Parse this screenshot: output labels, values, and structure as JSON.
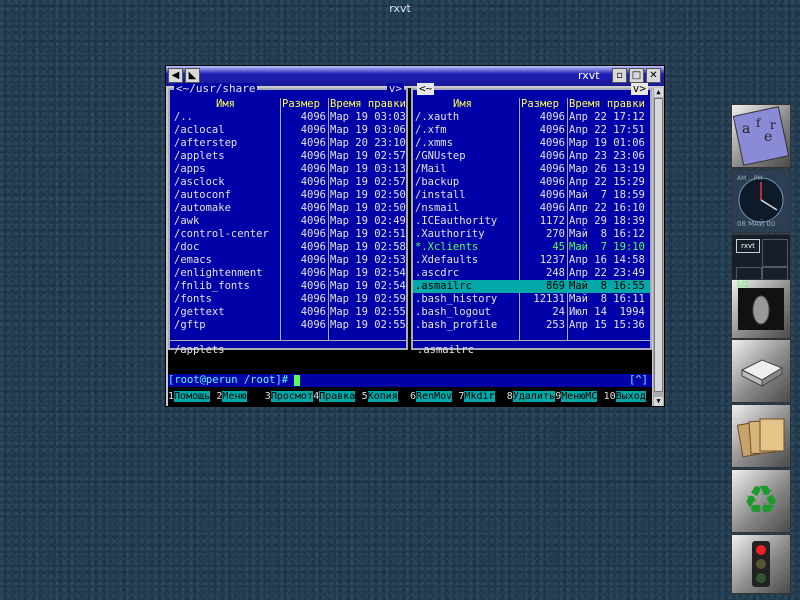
{
  "desktop": {
    "top_title": "rxvt"
  },
  "window": {
    "title": "rxvt",
    "left_panel": {
      "path": "<~/usr/share",
      "path_indicator": "v>",
      "headers": {
        "name": "Имя",
        "size": "Размер",
        "time": "Время правки"
      },
      "rows": [
        {
          "name": "/..",
          "size": "4096",
          "time": "Мар 19 03:03"
        },
        {
          "name": "/aclocal",
          "size": "4096",
          "time": "Мар 19 03:06"
        },
        {
          "name": "/afterstep",
          "size": "4096",
          "time": "Мар 20 23:10"
        },
        {
          "name": "/applets",
          "size": "4096",
          "time": "Мар 19 02:57"
        },
        {
          "name": "/apps",
          "size": "4096",
          "time": "Мар 19 03:13"
        },
        {
          "name": "/asclock",
          "size": "4096",
          "time": "Мар 19 02:57"
        },
        {
          "name": "/autoconf",
          "size": "4096",
          "time": "Мар 19 02:50"
        },
        {
          "name": "/automake",
          "size": "4096",
          "time": "Мар 19 02:50"
        },
        {
          "name": "/awk",
          "size": "4096",
          "time": "Мар 19 02:49"
        },
        {
          "name": "/control-center",
          "size": "4096",
          "time": "Мар 19 02:51"
        },
        {
          "name": "/doc",
          "size": "4096",
          "time": "Мар 19 02:58"
        },
        {
          "name": "/emacs",
          "size": "4096",
          "time": "Мар 19 02:53"
        },
        {
          "name": "/enlightenment",
          "size": "4096",
          "time": "Мар 19 02:54"
        },
        {
          "name": "/fnlib_fonts",
          "size": "4096",
          "time": "Мар 19 02:54"
        },
        {
          "name": "/fonts",
          "size": "4096",
          "time": "Мар 19 02:59"
        },
        {
          "name": "/gettext",
          "size": "4096",
          "time": "Мар 19 02:55"
        },
        {
          "name": "/gftp",
          "size": "4096",
          "time": "Мар 19 02:55"
        }
      ],
      "mini_status": "/applets"
    },
    "right_panel": {
      "path": "<~",
      "path_indicator": "v>",
      "headers": {
        "name": "Имя",
        "size": "Размер",
        "time": "Время правки"
      },
      "rows": [
        {
          "name": "/.xauth",
          "size": "4096",
          "time": "Апр 22 17:12"
        },
        {
          "name": "/.xfm",
          "size": "4096",
          "time": "Апр 22 17:51"
        },
        {
          "name": "/.xmms",
          "size": "4096",
          "time": "Мар 19 01:06"
        },
        {
          "name": "/GNUstep",
          "size": "4096",
          "time": "Апр 23 23:06"
        },
        {
          "name": "/Mail",
          "size": "4096",
          "time": "Мар 26 13:19"
        },
        {
          "name": "/backup",
          "size": "4096",
          "time": "Апр 22 15:29"
        },
        {
          "name": "/install",
          "size": "4096",
          "time": "Май  7 18:59"
        },
        {
          "name": "/nsmail",
          "size": "4096",
          "time": "Апр 22 16:10"
        },
        {
          "name": " .ICEauthority",
          "size": "1172",
          "time": "Апр 29 18:39"
        },
        {
          "name": " .Xauthority",
          "size": "270",
          "time": "Май  8 16:12"
        },
        {
          "name": "*.Xclients",
          "size": "45",
          "time": "Май  7 19:10"
        },
        {
          "name": " .Xdefaults",
          "size": "1237",
          "time": "Апр 16 14:58"
        },
        {
          "name": " .ascdrc",
          "size": "248",
          "time": "Апр 22 23:49"
        },
        {
          "name": " .asmailrc",
          "size": "869",
          "time": "Май  8 16:55"
        },
        {
          "name": " .bash_history",
          "size": "12131",
          "time": "Май  8 16:11"
        },
        {
          "name": " .bash_logout",
          "size": "24",
          "time": "Июл 14  1994"
        },
        {
          "name": " .bash_profile",
          "size": "253",
          "time": "Апр 15 15:36"
        }
      ],
      "mini_status": ".asmailrc"
    },
    "prompt": "[root@perun /root]#",
    "prompt_right": "[^]",
    "fkeys": [
      {
        "n": "1",
        "l": "Помощь"
      },
      {
        "n": "2",
        "l": "Меню"
      },
      {
        "n": "3",
        "l": "Просмот"
      },
      {
        "n": "4",
        "l": "Правка"
      },
      {
        "n": "5",
        "l": "Копия"
      },
      {
        "n": "6",
        "l": "RenMov"
      },
      {
        "n": "7",
        "l": "Mkdir"
      },
      {
        "n": "8",
        "l": "Удалить"
      },
      {
        "n": "9",
        "l": "МенюMC"
      },
      {
        "n": "10",
        "l": "Выход"
      }
    ]
  },
  "dock": {
    "clock_top": "AM .. PM",
    "clock_date": "08 МАЙ 00",
    "pager_label": "rxvt",
    "mini_counter": "1/2"
  }
}
